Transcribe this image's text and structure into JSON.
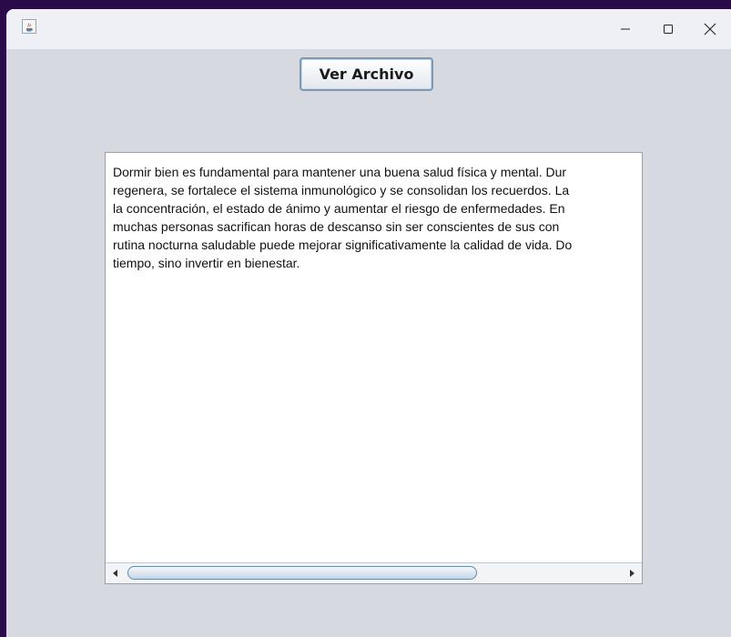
{
  "window": {
    "title": "",
    "controls": {
      "minimize": "minimize-icon",
      "maximize": "maximize-icon",
      "close": "close-icon"
    }
  },
  "toolbar": {
    "ver_archivo_label": "Ver Archivo"
  },
  "text_area": {
    "lines": [
      "Dormir bien es fundamental para mantener una buena salud física y mental. Dur",
      "regenera, se fortalece el sistema inmunológico y se consolidan los recuerdos. La",
      "la concentración, el estado de ánimo y aumentar el riesgo de enfermedades. En",
      "muchas personas sacrifican horas de descanso sin ser conscientes de sus con",
      "rutina nocturna saludable puede mejorar significativamente la calidad de vida. Do",
      "tiempo, sino invertir en bienestar."
    ]
  },
  "horizontal_scrollbar": {
    "position_fraction": 0.0,
    "visible_fraction": 0.71
  }
}
